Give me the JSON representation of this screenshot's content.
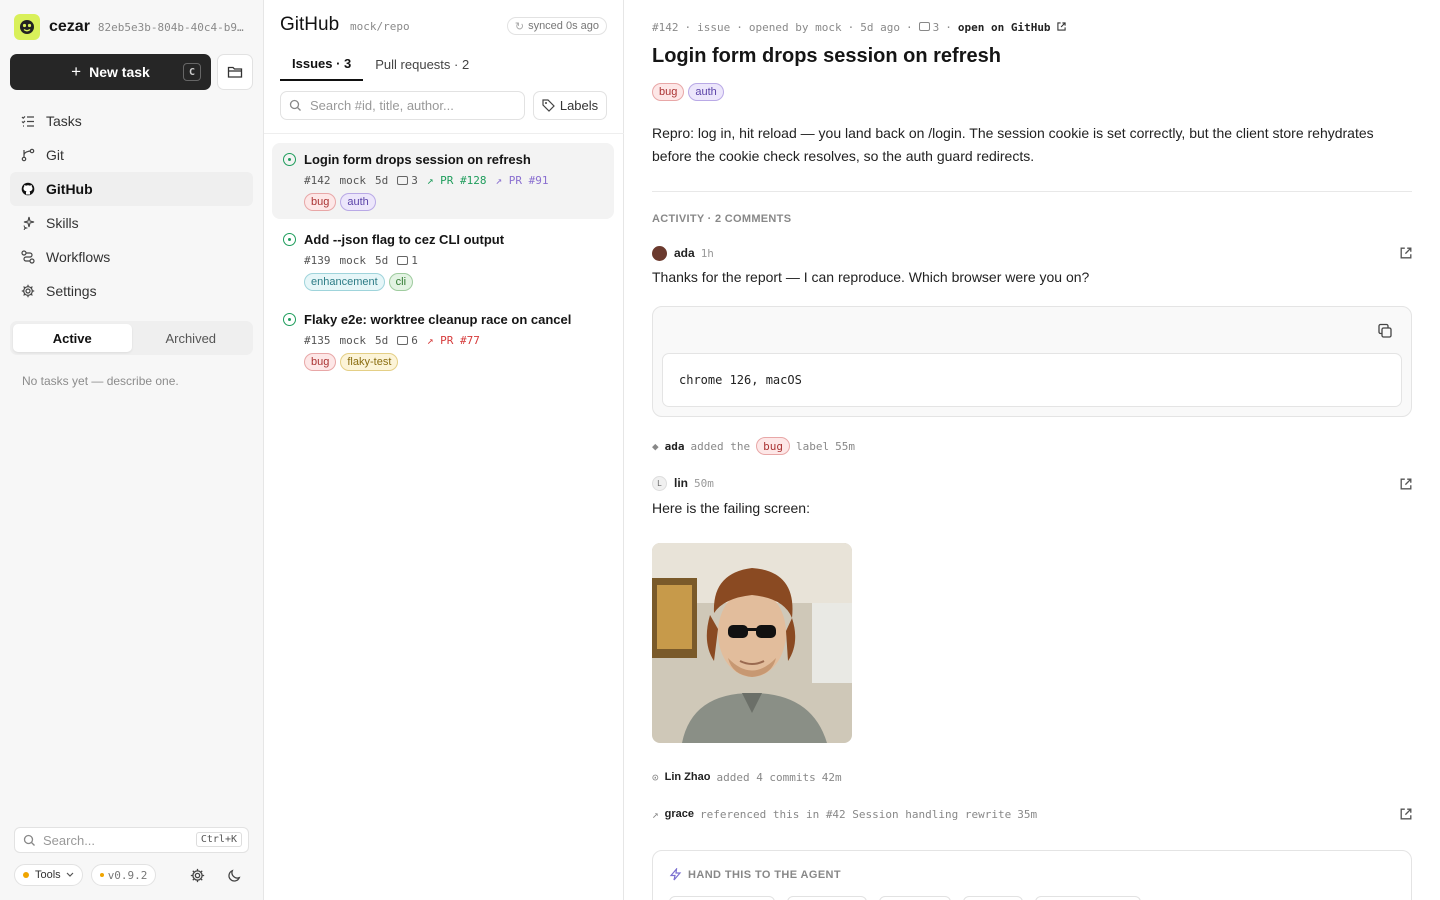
{
  "sidebar": {
    "app_name": "cezar",
    "task_id": "82eb5e3b-804b-40c4-b9…",
    "new_task_label": "New task",
    "new_task_shortcut": "C",
    "nav": [
      {
        "label": "Tasks",
        "icon": "list-check-icon"
      },
      {
        "label": "Git",
        "icon": "git-branch-icon"
      },
      {
        "label": "GitHub",
        "icon": "github-icon",
        "active": true
      },
      {
        "label": "Skills",
        "icon": "sparkle-icon"
      },
      {
        "label": "Workflows",
        "icon": "workflow-icon"
      },
      {
        "label": "Settings",
        "icon": "gear-icon"
      }
    ],
    "segment": {
      "active": "Active",
      "archived": "Archived"
    },
    "empty_text": "No tasks yet — describe one.",
    "search_placeholder": "Search...",
    "search_shortcut": "Ctrl+K",
    "tools_label": "Tools",
    "version": "v0.9.2"
  },
  "list": {
    "title": "GitHub",
    "repo": "mock/repo",
    "synced": "synced 0s ago",
    "tabs": [
      "Issues · 3",
      "Pull requests · 2"
    ],
    "search_placeholder": "Search #id, title, author...",
    "labels_button": "Labels",
    "issues": [
      {
        "title": "Login form drops session on refresh",
        "num": "#142",
        "author": "mock",
        "age": "5d",
        "comments": "3",
        "prs": [
          {
            "label": "PR #128",
            "color": "#1f9d5c"
          },
          {
            "label": "PR #91",
            "color": "#8a6fd0"
          }
        ],
        "tags": [
          "bug",
          "auth"
        ]
      },
      {
        "title": "Add --json flag to cez CLI output",
        "num": "#139",
        "author": "mock",
        "age": "5d",
        "comments": "1",
        "prs": [],
        "tags": [
          "enhancement",
          "cli"
        ]
      },
      {
        "title": "Flaky e2e: worktree cleanup race on cancel",
        "num": "#135",
        "author": "mock",
        "age": "5d",
        "comments": "6",
        "prs": [
          {
            "label": "PR #77",
            "color": "#d63b3b"
          }
        ],
        "tags": [
          "bug",
          "flaky-test"
        ]
      }
    ]
  },
  "detail": {
    "meta": {
      "num": "#142",
      "kind": "issue",
      "opened": "opened by mock",
      "age": "5d ago",
      "comments": "3",
      "open_link": "open on GitHub"
    },
    "title": "Login form drops session on refresh",
    "tags": [
      "bug",
      "auth"
    ],
    "body": "Repro: log in, hit reload — you land back on /login. The session cookie is set correctly, but the client store rehydrates before the cookie check resolves, so the auth guard redirects.",
    "activity_header": "ACTIVITY · 2 COMMENTS",
    "comment1": {
      "author": "ada",
      "time": "1h",
      "text": "Thanks for the report — I can reproduce. Which browser were you on?",
      "code": "chrome 126, macOS"
    },
    "event_label": {
      "actor": "ada",
      "pre": "added the",
      "label": "bug",
      "post": "label",
      "time": "55m"
    },
    "comment2": {
      "author": "lin",
      "initial": "L",
      "time": "50m",
      "text": "Here is the failing screen:"
    },
    "event_commits": {
      "actor": "Lin Zhao",
      "text": "added 4 commits",
      "time": "42m"
    },
    "event_ref": {
      "actor": "grace",
      "text": "referenced this in #42 Session handling rewrite",
      "time": "35m"
    },
    "agent_header": "HAND THIS TO THE AGENT"
  }
}
